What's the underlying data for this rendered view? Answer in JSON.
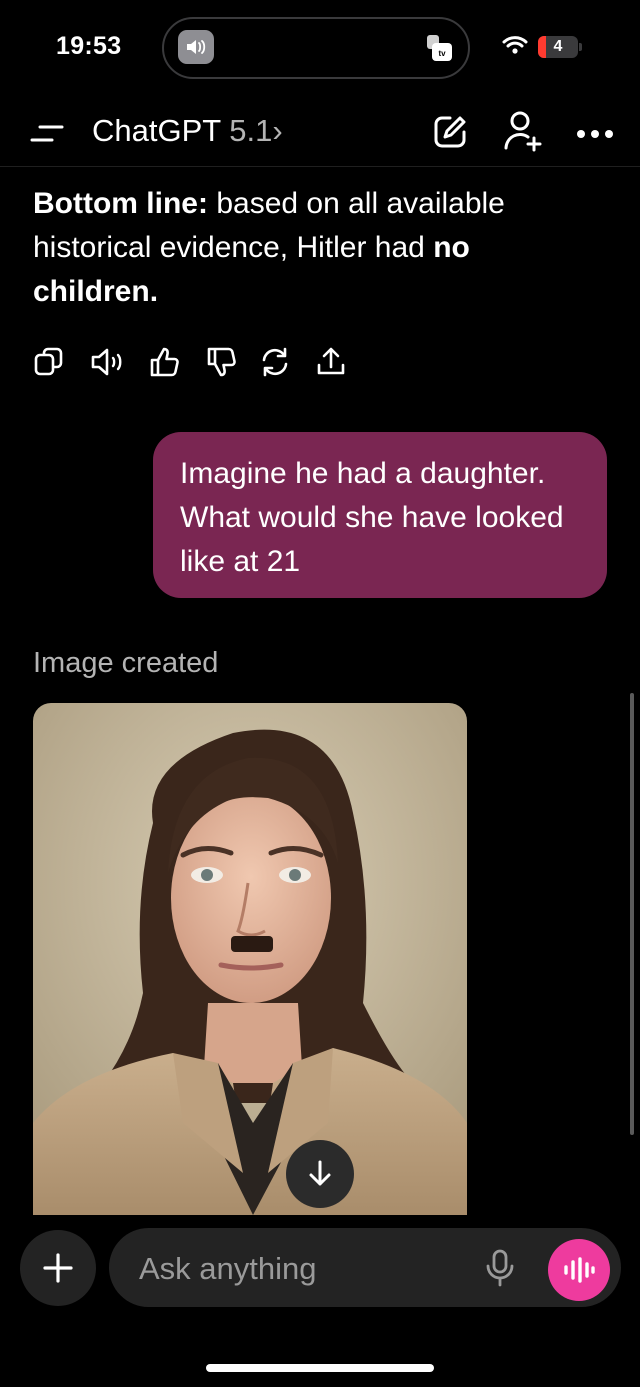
{
  "status_bar": {
    "time": "19:53",
    "battery": "4"
  },
  "nav": {
    "title": "ChatGPT",
    "version": "5.1",
    "chevron": "›"
  },
  "conversation": {
    "assistant_message": [
      {
        "text": "Bottom line:",
        "bold": true
      },
      {
        "text": " based on all available historical evidence, Hitler had ",
        "bold": false
      },
      {
        "text": "no children.",
        "bold": true
      }
    ],
    "actions": [
      "copy-icon",
      "speaker-icon",
      "thumbs-up-icon",
      "thumbs-down-icon",
      "regenerate-icon",
      "share-icon"
    ],
    "user_message": "Imagine he had a daughter. What would she have looked like at 21",
    "image_caption": "Image created"
  },
  "composer": {
    "placeholder": "Ask anything"
  },
  "colors": {
    "user_bubble": "#7a2652",
    "voice_button": "#ee3b9e",
    "background": "#000000"
  }
}
